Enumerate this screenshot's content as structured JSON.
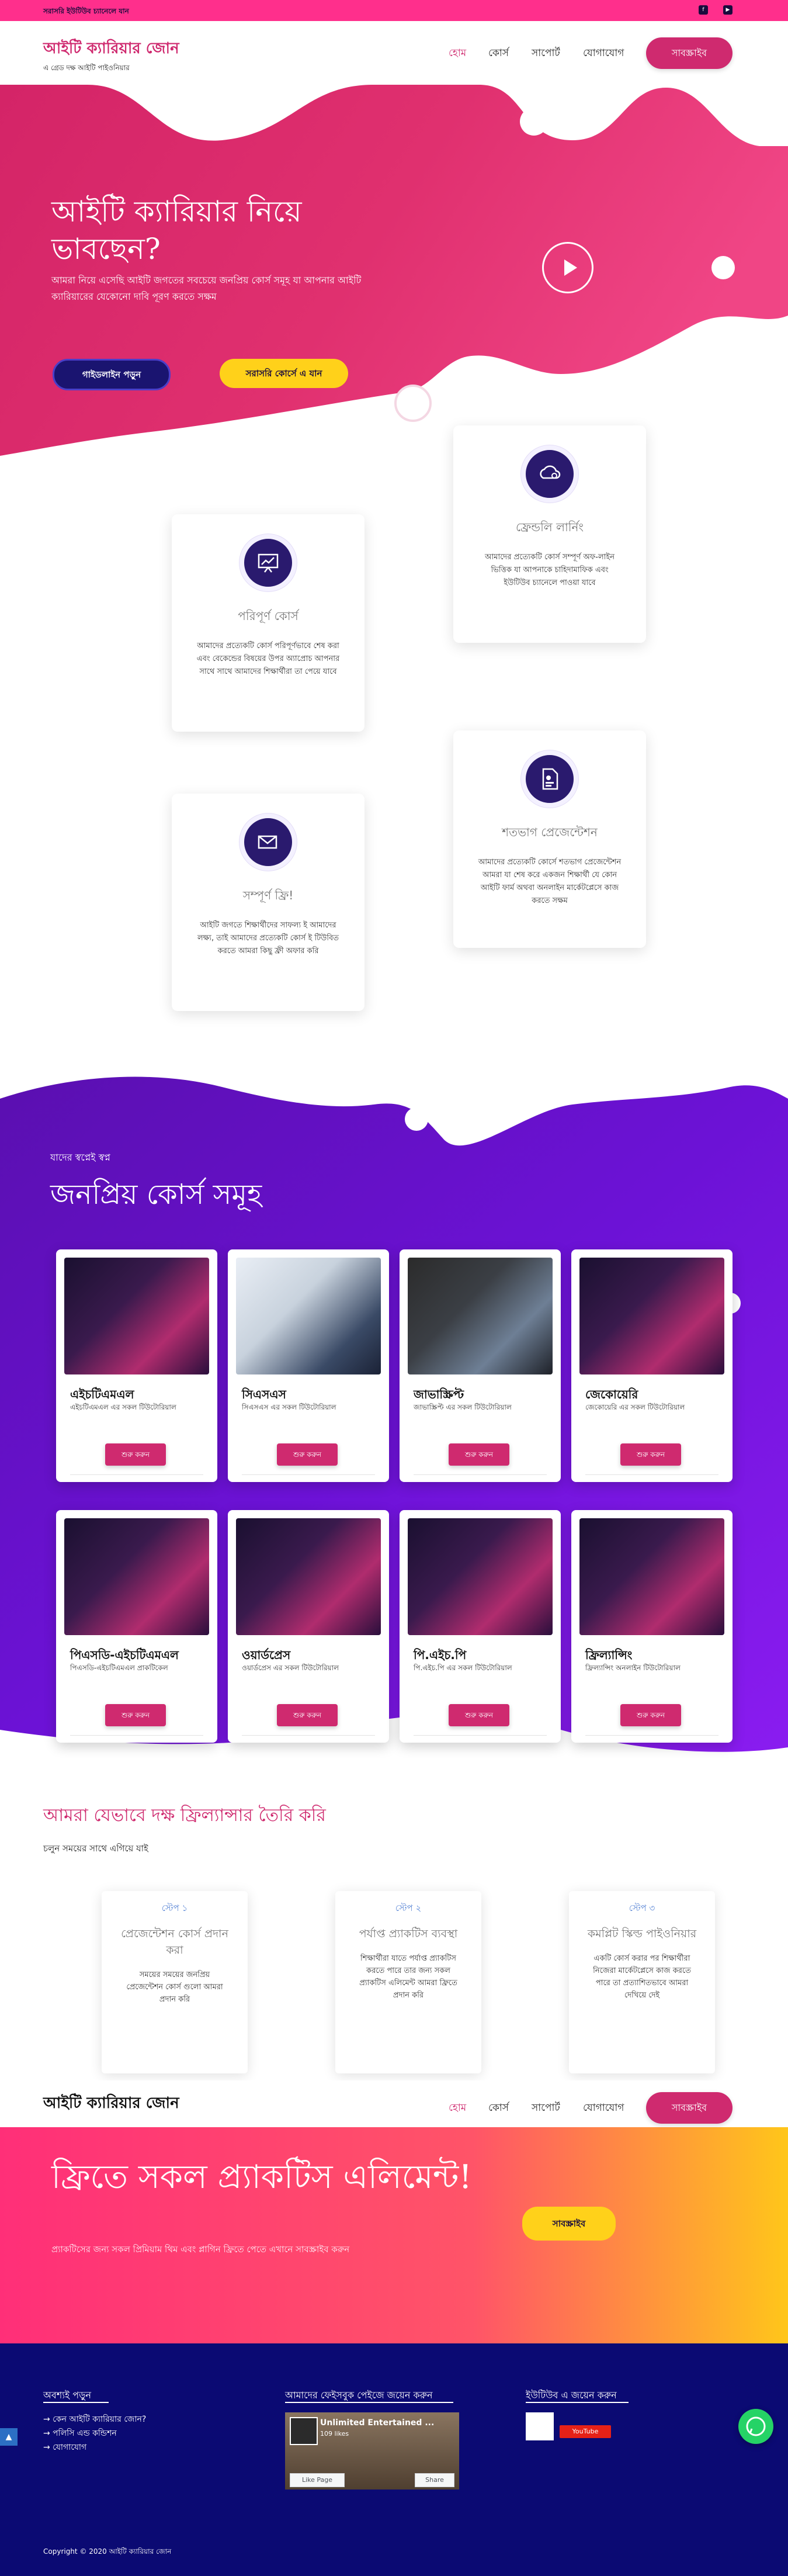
{
  "topbar": {
    "text": "সরাসরি ইউটিউব চ্যানেলে যান",
    "icons": [
      "facebook-icon",
      "youtube-icon"
    ]
  },
  "header": {
    "logo_title": "আইটি ক্যারিয়ার জোন",
    "logo_subtitle": "এ গ্রেড দক্ষ আইটি পাইওনিয়ার",
    "nav": [
      "হোম",
      "কোর্স",
      "সাপোর্ট",
      "যোগাযোগ"
    ],
    "subscribe": "সাবস্ক্রাইব"
  },
  "hero": {
    "title": "আইটি ক্যারিয়ার নিয়ে ভাবছেন?",
    "subtitle": "আমরা নিয়ে এসেছি আইটি জগতের সবচেয়ে জনপ্রিয় কোর্স সমূহ যা আপনার আইটি ক্যারিয়ারের যেকোনো দাবি পূরণ করতে সক্ষম",
    "btn_guideline": "গাইডলাইন পড়ুন",
    "btn_course": "সরাসরি কোর্সে এ যান"
  },
  "features": [
    {
      "title": "ফ্রেন্ডলি লার্নিং",
      "text": "আমাদের প্রত্যেকটি কোর্স সম্পূর্ণ অফ-লাইন ভিত্তিক যা আপনাকে চাহিদামাফিক এবং ইউটিউব চ্যানেলে পাওয়া যাবে",
      "icon": "cloud-icon"
    },
    {
      "title": "পরিপূর্ণ কোর্স",
      "text": "আমাদের প্রত্যেকটি কোর্স পরিপূর্ণভাবে শেষ করা এবং বেকেন্ডের বিষয়ের উপর অ্যাপ্রোচ আপনার সাথে সাথে আমাদের শিক্ষার্থীরা তা পেয়ে যাবে",
      "icon": "chart-board-icon"
    },
    {
      "title": "শতভাগ প্রেজেন্টেশন",
      "text": "আমাদের প্রত্যেকটি কোর্সে শতভাগ প্রেজেন্টেশন আমরা যা শেষ করে একজন শিক্ষার্থী যে কোন আইটি ফার্ম অথবা অনলাইন মার্কেটপ্লেসে কাজ করতে সক্ষম",
      "icon": "document-icon"
    },
    {
      "title": "সম্পূর্ণ ফ্রি!",
      "text": "আইটি জগতে শিক্ষার্থীদের সাফল্য ই আমাদের লক্ষ্য, তাই আমাদের প্রত্যেকটি কোর্স ই টিউবিত করতে আমরা কিছু ফ্রী অফার করি",
      "icon": "send-icon"
    }
  ],
  "courses": {
    "kicker": "যাদের স্বপ্নেই স্বপ্ন",
    "title": "জনপ্রিয় কোর্স সমূহ",
    "start_label": "শুরু করুন",
    "items": [
      {
        "title": "এইচটিএমএল",
        "desc": "এইচটিএমএল এর সকল টিউটোরিয়াল",
        "img": "laptop-dark"
      },
      {
        "title": "সিএসএস",
        "desc": "সিএসএস এর সকল টিউটোরিয়াল",
        "img": "laptop-hands"
      },
      {
        "title": "জাভাস্ক্রিপ্ট",
        "desc": "জাভাস্ক্রিপ্ট এর সকল টিউটোরিয়াল",
        "img": "laptop-code"
      },
      {
        "title": "জেকোয়েরি",
        "desc": "জেকোয়েরি এর সকল টিউটোরিয়াল",
        "img": "laptop-dark"
      },
      {
        "title": "পিএসডি-এইচটিএমএল",
        "desc": "পিএসডি-এইচটিএমএল প্রাকটিকেল",
        "img": "laptop-dark"
      },
      {
        "title": "ওয়ার্ডপ্রেস",
        "desc": "ওয়ার্ডপ্রেস এর সকল টিউটোরিয়াল",
        "img": "laptop-dark"
      },
      {
        "title": "পি.এইচ.পি",
        "desc": "পি.এইচ.পি এর সকল টিউটোরিয়াল",
        "img": "laptop-dark"
      },
      {
        "title": "ফ্রিল্যান্সিং",
        "desc": "ফ্রিল্যান্সিং অনলাইন টিউটোরিয়াল",
        "img": "laptop-dark"
      }
    ]
  },
  "freelancer": {
    "title": "আমরা যেভাবে দক্ষ ফ্রিল্যান্সার তৈরি করি",
    "subtitle": "চলুন সময়ের সাথে এগিয়ে যাই",
    "steps": [
      {
        "num": "স্টেপ ১",
        "title": "প্রেজেন্টেশন কোর্স প্রদান করা",
        "text": "সময়ের সময়ের জনপ্রিয় প্রেজেন্টেশন কোর্স গুলো আমরা প্রদান করি"
      },
      {
        "num": "স্টেপ ২",
        "title": "পর্যাপ্ত প্র্যাকটিস ব্যবস্থা",
        "text": "শিক্ষার্থীরা যাতে পর্যাপ্ত প্র্যাকটিস করতে পারে তার জন্য সকল প্র্যাকটিস এলিমেন্ট আমরা ফ্রিতে প্রদান করি"
      },
      {
        "num": "স্টেপ ৩",
        "title": "কমপ্লিট স্কিল্ড পাইওনিয়ার",
        "text": "একটি কোর্স করার পর শিক্ষার্থীরা নিজেরা মার্কেটপ্লেসে কাজ করতে পারে তা প্রত্যাশিতভাবে আমরা দেখিয়ে দেই"
      }
    ]
  },
  "sticky": {
    "logo_title": "আইটি ক্যারিয়ার জোন",
    "nav": [
      "হোম",
      "কোর্স",
      "সাপোর্ট",
      "যোগাযোগ"
    ],
    "subscribe": "সাবস্ক্রাইব"
  },
  "cta": {
    "title": "ফ্রিতে সকল প্র্যাকটিস এলিমেন্ট!",
    "subtitle": "প্র্যাকটিসের জন্য সকল প্রিমিয়াম থিম এবং প্লাগিন ফ্রিতে পেতে এখানে সাবস্ক্রাইব করুন",
    "button": "সাবস্ক্রাইব"
  },
  "footer": {
    "col1_title": "অবশ্যই পড়ুন",
    "links": [
      "→ কেন আইটি ক্যারিয়ার জোন?",
      "→ পলিসি এন্ড কন্ডিশন",
      "→ যোগাযোগ"
    ],
    "col2_title": "আমাদের ফেইসবুক পেইজে জয়েন করুন",
    "fb_page_name": "Unlimited Entertained ...",
    "fb_likes": "109 likes",
    "fb_like_btn": "Like Page",
    "fb_share_btn": "Share",
    "col3_title": "ইউটিউব এ জয়েন করুন",
    "yt_button": "YouTube",
    "copyright": "Copyright © 2020 আইটি ক্যারিয়ার জোন",
    "colors": {
      "footer_bg": "#0b0a73",
      "accent": "#cf2a6f",
      "pink": "#ff2f8c",
      "purple": "#6a11d8"
    }
  }
}
